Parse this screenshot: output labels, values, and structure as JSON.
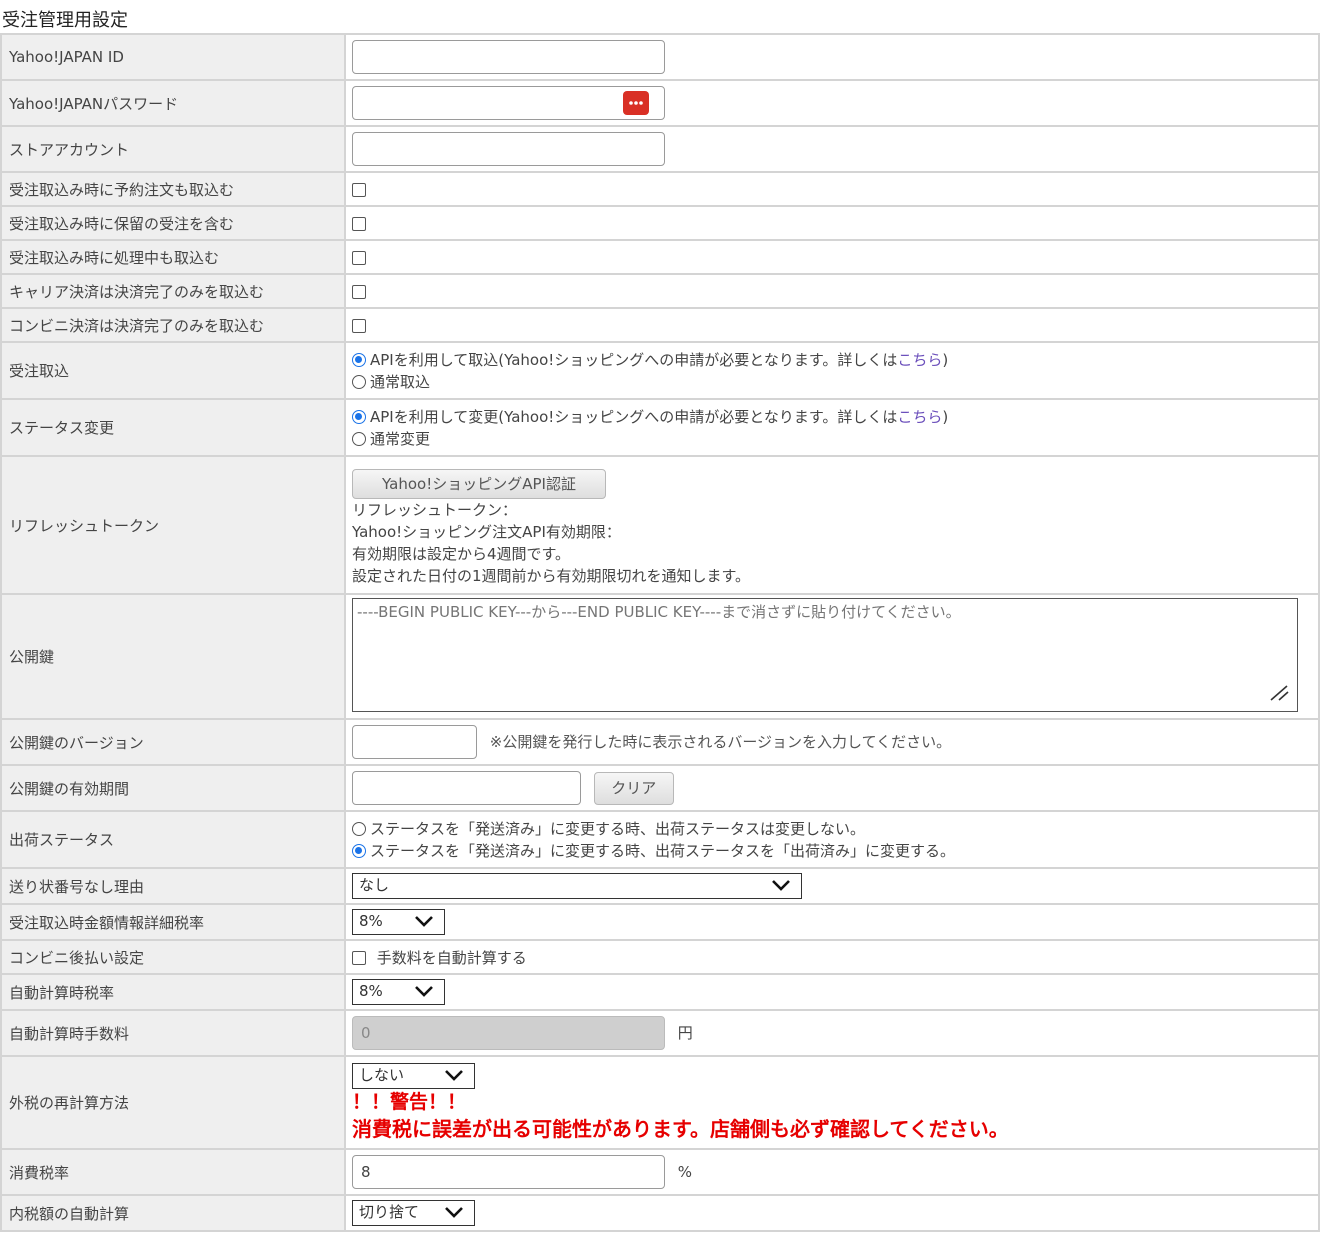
{
  "page_title": "受注管理用設定",
  "rows": {
    "yahoo_id": {
      "label": "Yahoo!JAPAN ID",
      "value": ""
    },
    "yahoo_password": {
      "label": "Yahoo!JAPANパスワード",
      "value": "",
      "icon": "password-manager-icon"
    },
    "store_account": {
      "label": "ストアアカウント",
      "value": ""
    },
    "reservation": {
      "label": "受注取込み時に予約注文も取込む",
      "checked": false
    },
    "hold": {
      "label": "受注取込み時に保留の受注を含む",
      "checked": false
    },
    "processing": {
      "label": "受注取込み時に処理中も取込む",
      "checked": false
    },
    "carrier": {
      "label": "キャリア決済は決済完了のみを取込む",
      "checked": false
    },
    "convenience": {
      "label": "コンビニ決済は決済完了のみを取込む",
      "checked": false
    },
    "order_import": {
      "label": "受注取込",
      "option_api_text": "APIを利用して取込(Yahoo!ショッピングへの申請が必要となります。詳しくは",
      "link": "こちら",
      "close_paren": ")",
      "option_normal": "通常取込",
      "selected": "api"
    },
    "status_change": {
      "label": "ステータス変更",
      "option_api_text": "APIを利用して変更(Yahoo!ショッピングへの申請が必要となります。詳しくは",
      "link": "こちら",
      "close_paren": ")",
      "option_normal": "通常変更",
      "selected": "api"
    },
    "refresh_token": {
      "label": "リフレッシュトークン",
      "button": "Yahoo!ショッピングAPI認証",
      "line1": "リフレッシュトークン：",
      "line2": "Yahoo!ショッピング注文API有効期限：",
      "line3": "有効期限は設定から4週間です。",
      "line4": "設定された日付の1週間前から有効期限切れを通知します。"
    },
    "public_key": {
      "label": "公開鍵",
      "placeholder": "----BEGIN PUBLIC KEY---から---END PUBLIC KEY----まで消さずに貼り付けてください。"
    },
    "key_version": {
      "label": "公開鍵のバージョン",
      "value": "",
      "note": "※公開鍵を発行した時に表示されるバージョンを入力してください。"
    },
    "key_validity": {
      "label": "公開鍵の有効期間",
      "value": "",
      "button": "クリア"
    },
    "shipping_status": {
      "label": "出荷ステータス",
      "option1": "ステータスを「発送済み」に変更する時、出荷ステータスは変更しない。",
      "option2": "ステータスを「発送済み」に変更する時、出荷ステータスを「出荷済み」に変更する。",
      "selected": "option2"
    },
    "no_tracking_reason": {
      "label": "送り状番号なし理由",
      "selected": "なし"
    },
    "amount_tax_rate": {
      "label": "受注取込時金額情報詳細税率",
      "selected": "8%"
    },
    "cod_setting": {
      "label": "コンビニ後払い設定",
      "checkbox_label": "手数料を自動計算する",
      "checked": false
    },
    "auto_tax_rate": {
      "label": "自動計算時税率",
      "selected": "8%"
    },
    "auto_fee": {
      "label": "自動計算時手数料",
      "value": "0",
      "unit": "円"
    },
    "external_tax": {
      "label": "外税の再計算方法",
      "selected": "しない",
      "warning_title": "！！警告！！",
      "warning_text": "消費税に誤差が出る可能性があります。店舗側も必ず確認してください。"
    },
    "consumption_tax": {
      "label": "消費税率",
      "value": "8",
      "unit": "%"
    },
    "inner_tax_auto": {
      "label": "内税額の自動計算",
      "selected": "切り捨て"
    }
  },
  "colors": {
    "warning": "#e60000",
    "radio_selected": "#1a73e8",
    "link": "#6b4fbb",
    "label_bg": "#efefef"
  }
}
